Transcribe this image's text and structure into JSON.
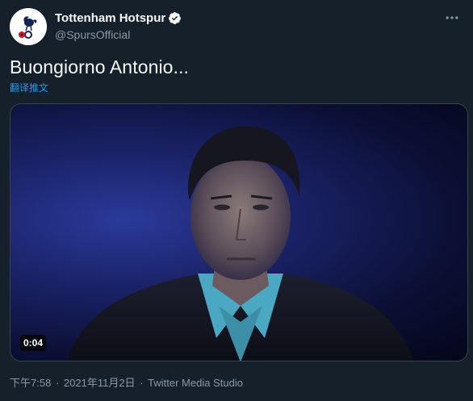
{
  "author": {
    "display_name": "Tottenham Hotspur",
    "handle": "@SpursOfficial",
    "verified": true,
    "avatar_icon": "tottenham-cockerel-logo"
  },
  "tweet": {
    "text": "Buongiorno Antonio...",
    "translate_label": "翻译推文"
  },
  "media": {
    "type": "video",
    "duration": "0:04"
  },
  "meta": {
    "time": "下午7:58",
    "separator": "·",
    "date": "2021年11月2日",
    "source": "Twitter Media Studio"
  },
  "colors": {
    "background": "#15202b",
    "text_primary": "#f7f9f9",
    "text_secondary": "#8b98a5",
    "accent": "#1d9bf0",
    "border": "#38444d"
  },
  "icons": {
    "more": "more-dots-icon",
    "verified": "verified-badge-icon"
  }
}
